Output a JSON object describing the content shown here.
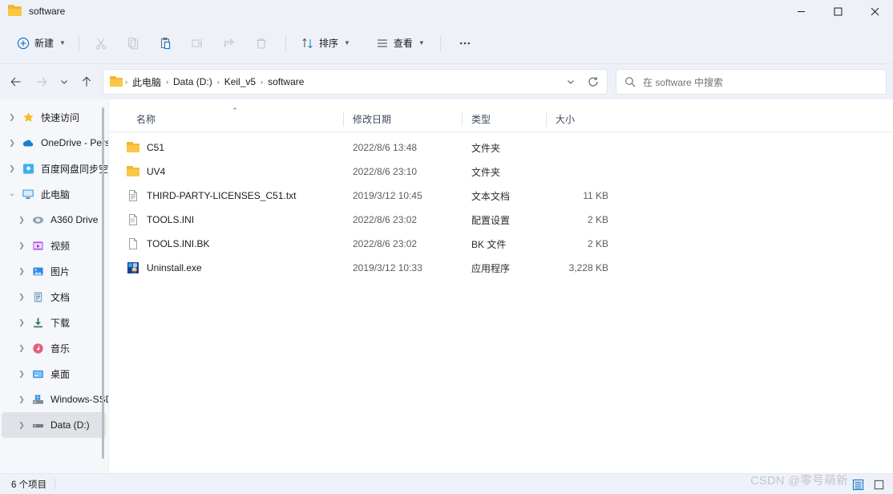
{
  "window": {
    "title": "software",
    "controls": {
      "minimize": "minimize-button",
      "maximize": "maximize-button",
      "close": "close-button"
    }
  },
  "toolbar": {
    "new_label": "新建",
    "cut_label": "剪切",
    "copy_label": "复制",
    "paste_label": "粘贴",
    "rename_label": "重命名",
    "share_label": "共享",
    "delete_label": "删除",
    "sort_label": "排序",
    "view_label": "查看",
    "more_label": "查看更多"
  },
  "address": {
    "crumbs": [
      "此电脑",
      "Data (D:)",
      "Keil_v5",
      "software"
    ],
    "separator": "›",
    "dropdown_label": "历史记录",
    "refresh_label": "刷新"
  },
  "search": {
    "placeholder": "在 software 中搜索"
  },
  "sidebar": {
    "items": [
      {
        "label": "快速访问",
        "icon": "star-icon",
        "level": 1,
        "expanded": false,
        "selected": false
      },
      {
        "label": "OneDrive - Pers",
        "icon": "onedrive-icon",
        "level": 1,
        "expanded": false,
        "selected": false
      },
      {
        "label": "百度网盘同步空",
        "icon": "baidu-netdisk-icon",
        "level": 1,
        "expanded": false,
        "selected": false
      },
      {
        "label": "此电脑",
        "icon": "this-pc-icon",
        "level": 1,
        "expanded": true,
        "selected": false
      },
      {
        "label": "A360 Drive",
        "icon": "a360-drive-icon",
        "level": 2,
        "expanded": false,
        "selected": false
      },
      {
        "label": "视频",
        "icon": "videos-icon",
        "level": 2,
        "expanded": false,
        "selected": false
      },
      {
        "label": "图片",
        "icon": "pictures-icon",
        "level": 2,
        "expanded": false,
        "selected": false
      },
      {
        "label": "文档",
        "icon": "documents-icon",
        "level": 2,
        "expanded": false,
        "selected": false
      },
      {
        "label": "下载",
        "icon": "downloads-icon",
        "level": 2,
        "expanded": false,
        "selected": false
      },
      {
        "label": "音乐",
        "icon": "music-icon",
        "level": 2,
        "expanded": false,
        "selected": false
      },
      {
        "label": "桌面",
        "icon": "desktop-icon",
        "level": 2,
        "expanded": false,
        "selected": false
      },
      {
        "label": "Windows-SSD",
        "icon": "windows-drive-icon",
        "level": 2,
        "expanded": false,
        "selected": false
      },
      {
        "label": "Data (D:)",
        "icon": "drive-icon",
        "level": 2,
        "expanded": false,
        "selected": true
      }
    ]
  },
  "filelist": {
    "columns": [
      "名称",
      "修改日期",
      "类型",
      "大小"
    ],
    "sort_column": "名称",
    "sort_direction": "asc",
    "rows": [
      {
        "name": "C51",
        "date": "2022/8/6 13:48",
        "type": "文件夹",
        "size": "",
        "icon": "folder-icon"
      },
      {
        "name": "UV4",
        "date": "2022/8/6 23:10",
        "type": "文件夹",
        "size": "",
        "icon": "folder-icon"
      },
      {
        "name": "THIRD-PARTY-LICENSES_C51.txt",
        "date": "2019/3/12 10:45",
        "type": "文本文档",
        "size": "11 KB",
        "icon": "text-file-icon"
      },
      {
        "name": "TOOLS.INI",
        "date": "2022/8/6 23:02",
        "type": "配置设置",
        "size": "2 KB",
        "icon": "ini-file-icon"
      },
      {
        "name": "TOOLS.INI.BK",
        "date": "2022/8/6 23:02",
        "type": "BK 文件",
        "size": "2 KB",
        "icon": "blank-file-icon"
      },
      {
        "name": "Uninstall.exe",
        "date": "2019/3/12 10:33",
        "type": "应用程序",
        "size": "3,228 KB",
        "icon": "exe-file-icon"
      }
    ]
  },
  "statusbar": {
    "item_count": "6 个项目",
    "details_view_label": "详细信息",
    "large_icons_view_label": "大图标"
  },
  "watermark": "CSDN @零号萌新",
  "colors": {
    "chrome": "#eef2f8",
    "accent": "#0a6cc4",
    "folder": "#fcc647",
    "selection": "#dfe2e6"
  }
}
